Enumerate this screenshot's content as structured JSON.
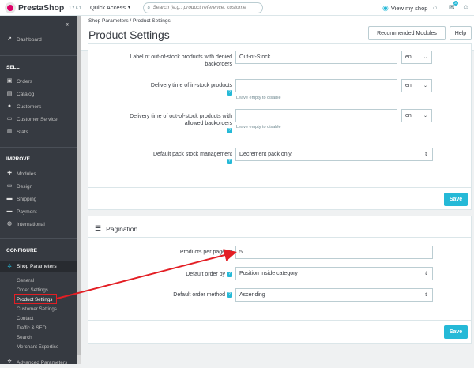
{
  "topbar": {
    "brand": "PrestaShop",
    "version": "1.7.6.1",
    "quick_access": "Quick Access",
    "search_placeholder": "Search (e.g.: product reference, custome",
    "view_shop": "View my shop",
    "notif_count": "3"
  },
  "sidebar": {
    "dashboard": "Dashboard",
    "sell_heading": "SELL",
    "sell_items": [
      "Orders",
      "Catalog",
      "Customers",
      "Customer Service",
      "Stats"
    ],
    "improve_heading": "IMPROVE",
    "improve_items": [
      "Modules",
      "Design",
      "Shipping",
      "Payment",
      "International"
    ],
    "configure_heading": "CONFIGURE",
    "shop_parameters": "Shop Parameters",
    "sub_items": [
      "General",
      "Order Settings",
      "Product Settings",
      "Customer Settings",
      "Contact",
      "Traffic & SEO",
      "Search",
      "Merchant Expertise"
    ],
    "advanced": "Advanced Parameters"
  },
  "header": {
    "breadcrumb_1": "Shop Parameters",
    "breadcrumb_sep": "/",
    "breadcrumb_2": "Product Settings",
    "title": "Product Settings",
    "recommended_modules": "Recommended Modules",
    "help": "Help"
  },
  "stock_card": {
    "label_denied": "Label of out-of-stock products with denied backorders",
    "label_denied_value": "Out-of-Stock",
    "lang": "en",
    "delivery_in_stock": "Delivery time of in-stock products",
    "delivery_in_stock_hint": "Leave empty to disable",
    "delivery_out_stock": "Delivery time of out-of-stock products with allowed backorders",
    "delivery_out_stock_hint": "Leave empty to disable",
    "pack_label": "Default pack stock management",
    "pack_value": "Decrement pack only.",
    "save": "Save"
  },
  "pagination_card": {
    "title": "Pagination",
    "products_per_page_label": "Products per page",
    "products_per_page_value": "5",
    "order_by_label": "Default order by",
    "order_by_value": "Position inside category",
    "order_method_label": "Default order method",
    "order_method_value": "Ascending",
    "save": "Save"
  },
  "colors": {
    "accent": "#25b9d7",
    "sidebar_bg": "#363a41",
    "annotation": "#e31e24"
  }
}
